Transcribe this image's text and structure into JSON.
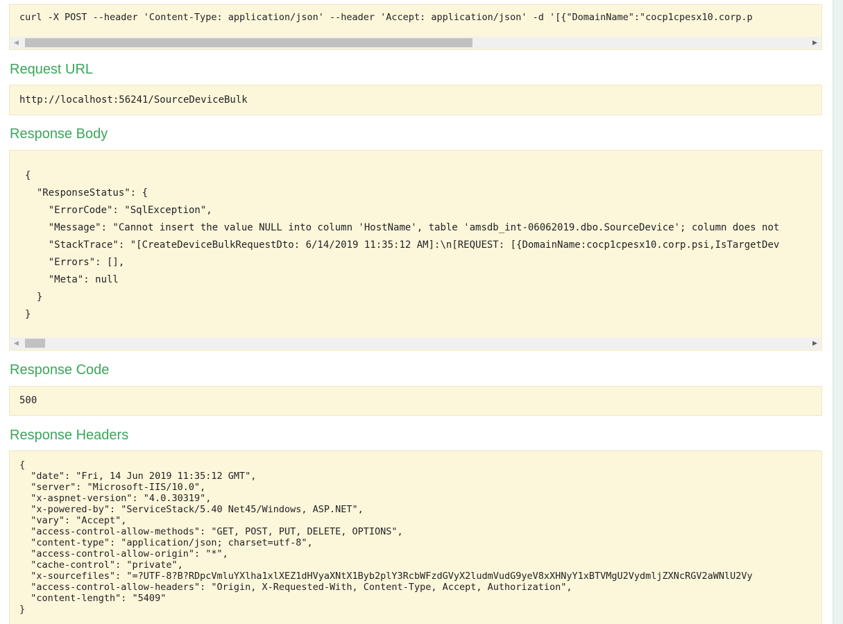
{
  "curl": {
    "command": "curl -X POST --header 'Content-Type: application/json' --header 'Accept: application/json' -d '[{\"DomainName\":\"cocp1cpesx10.corp.p"
  },
  "request_url": {
    "heading": "Request URL",
    "value": "http://localhost:56241/SourceDeviceBulk"
  },
  "response_body": {
    "heading": "Response Body",
    "lines": [
      "{",
      "  \"ResponseStatus\": {",
      "    \"ErrorCode\": \"SqlException\",",
      "    \"Message\": \"Cannot insert the value NULL into column 'HostName', table 'amsdb_int-06062019.dbo.SourceDevice'; column does not",
      "    \"StackTrace\": \"[CreateDeviceBulkRequestDto: 6/14/2019 11:35:12 AM]:\\n[REQUEST: [{DomainName:cocp1cpesx10.corp.psi,IsTargetDev",
      "    \"Errors\": [],",
      "    \"Meta\": null",
      "  }",
      "}"
    ]
  },
  "response_code": {
    "heading": "Response Code",
    "value": "500"
  },
  "response_headers": {
    "heading": "Response Headers",
    "lines": [
      "{",
      "  \"date\": \"Fri, 14 Jun 2019 11:35:12 GMT\",",
      "  \"server\": \"Microsoft-IIS/10.0\",",
      "  \"x-aspnet-version\": \"4.0.30319\",",
      "  \"x-powered-by\": \"ServiceStack/5.40 Net45/Windows, ASP.NET\",",
      "  \"vary\": \"Accept\",",
      "  \"access-control-allow-methods\": \"GET, POST, PUT, DELETE, OPTIONS\",",
      "  \"content-type\": \"application/json; charset=utf-8\",",
      "  \"access-control-allow-origin\": \"*\",",
      "  \"cache-control\": \"private\",",
      "  \"x-sourcefiles\": \"=?UTF-8?B?RDpcVmluYXlha1xlXEZ1dHVyaXNtX1Byb2plY3RcbWFzdGVyX2ludmVudG9yeV8xXHNyY1xBTVMgU2VydmljZXNcRGV2aWNlU2Vy",
      "  \"access-control-allow-headers\": \"Origin, X-Requested-With, Content-Type, Accept, Authorization\",",
      "  \"content-length\": \"5409\"",
      "}"
    ]
  },
  "icons": {
    "scroll_left": "◀",
    "scroll_right": "▶"
  },
  "colors": {
    "heading": "#3aa55a",
    "code_background": "#fcf6db",
    "page_background": "#ebf3f0"
  }
}
